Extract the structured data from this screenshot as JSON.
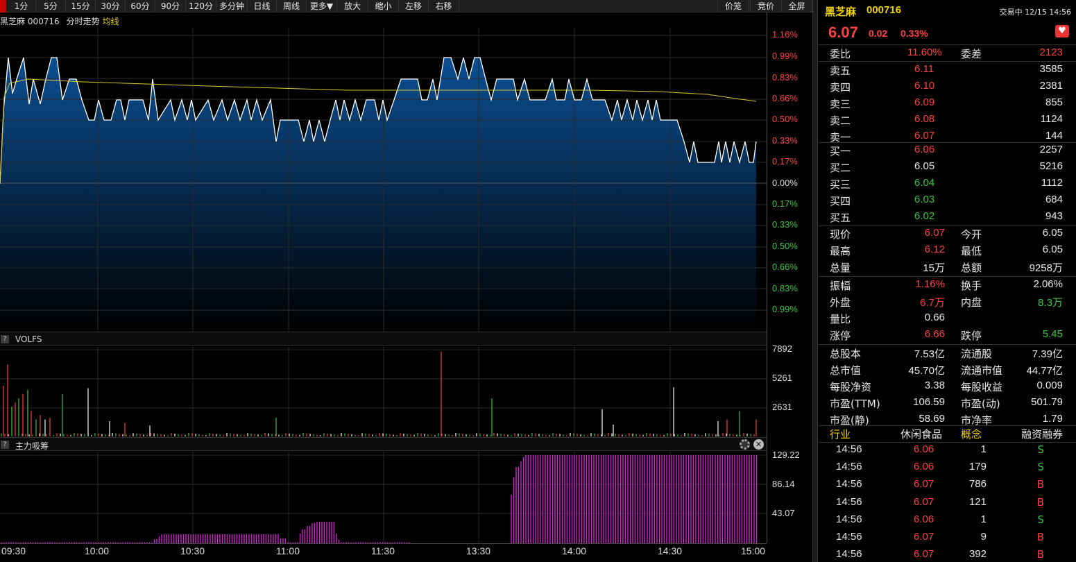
{
  "toolbar": {
    "items": [
      "1分",
      "5分",
      "15分",
      "30分",
      "60分",
      "90分",
      "120分",
      "多分钟",
      "日线",
      "周线",
      "更多▼",
      "放大",
      "缩小",
      "左移",
      "右移"
    ],
    "right_items": [
      "价笼",
      "竞价",
      "全屏"
    ]
  },
  "chart": {
    "stock_name": "黑芝麻",
    "stock_code": "000716",
    "subtitle": "分时走势",
    "avg_label": "均线",
    "pct_labels_up": [
      "1.16%",
      "0.99%",
      "0.83%",
      "0.66%",
      "0.50%",
      "0.33%",
      "0.17%"
    ],
    "zero_label": "0.00%",
    "pct_labels_down": [
      "0.17%",
      "0.33%",
      "0.50%",
      "0.66%",
      "0.83%",
      "0.99%"
    ],
    "colors": {
      "up": "#ff4040",
      "down": "#3cc43c",
      "fill_top": "#0b4f93",
      "avg": "#d8c830",
      "zl": "#e020e0"
    }
  },
  "chart_data": [
    {
      "type": "area",
      "title": "分时走势",
      "series": [
        {
          "name": "均线",
          "values": [
            6.05,
            6.1,
            6.1,
            6.098,
            6.096,
            6.094,
            6.093,
            6.092,
            6.091,
            6.09
          ]
        }
      ],
      "xlabel": "",
      "ylabel": "",
      "x": [
        "09:30",
        "10:00",
        "10:30",
        "11:00",
        "11:30",
        "13:30",
        "14:00",
        "14:30",
        "15:00"
      ],
      "ylim": [
        5.98,
        6.12
      ]
    },
    {
      "type": "bar",
      "title": "VOLFS",
      "ylim": [
        0,
        8000
      ],
      "tick_labels": [
        "7892",
        "5261",
        "2631"
      ],
      "peaks": [
        {
          "x": "11:45",
          "value": 7892
        },
        {
          "x": "09:31",
          "value": 6700
        }
      ]
    },
    {
      "type": "bar",
      "title": "主力吸筹",
      "ylim": [
        0,
        135
      ],
      "tick_labels": [
        "129.22",
        "86.14",
        "43.07"
      ],
      "segments": [
        {
          "from": "10:28",
          "to": "11:00",
          "value": 10
        },
        {
          "from": "11:03",
          "to": "11:17",
          "value": 30
        },
        {
          "from": "13:40",
          "to": "15:00",
          "value": 129.22
        }
      ]
    }
  ],
  "volume": {
    "title": "VOLFS",
    "labels": [
      "7892",
      "5261",
      "2631"
    ]
  },
  "zl": {
    "title": "主力吸筹",
    "labels": [
      "129.22",
      "86.14",
      "43.07"
    ]
  },
  "time_labels": [
    "09:30",
    "10:00",
    "10:30",
    "11:00",
    "11:30",
    "13:30",
    "14:00",
    "14:30",
    "15:00"
  ],
  "quote": {
    "name": "黑芝麻",
    "code": "000716",
    "status": "交易中 12/15 14:56",
    "price": "6.07",
    "change": "0.02",
    "change_pct": "0.33%",
    "weibi_label": "委比",
    "weibi": "11.60%",
    "weicha_label": "委差",
    "weicha": "2123",
    "asks": [
      {
        "label": "卖五",
        "price": "6.11",
        "vol": "3585"
      },
      {
        "label": "卖四",
        "price": "6.10",
        "vol": "2381"
      },
      {
        "label": "卖三",
        "price": "6.09",
        "vol": "855"
      },
      {
        "label": "卖二",
        "price": "6.08",
        "vol": "1124"
      },
      {
        "label": "卖一",
        "price": "6.07",
        "vol": "144"
      }
    ],
    "bids": [
      {
        "label": "买一",
        "price": "6.06",
        "vol": "2257",
        "c": "red"
      },
      {
        "label": "买二",
        "price": "6.05",
        "vol": "5216",
        "c": "white"
      },
      {
        "label": "买三",
        "price": "6.04",
        "vol": "1112",
        "c": "green"
      },
      {
        "label": "买四",
        "price": "6.03",
        "vol": "684",
        "c": "green"
      },
      {
        "label": "买五",
        "price": "6.02",
        "vol": "943",
        "c": "green"
      }
    ],
    "stats": [
      {
        "l1": "现价",
        "v1": "6.07",
        "c1": "red",
        "l2": "今开",
        "v2": "6.05",
        "c2": "white"
      },
      {
        "l1": "最高",
        "v1": "6.12",
        "c1": "red",
        "l2": "最低",
        "v2": "6.05",
        "c2": "white"
      },
      {
        "l1": "总量",
        "v1": "15万",
        "c1": "white",
        "l2": "总额",
        "v2": "9258万",
        "c2": "white"
      },
      {
        "l1": "振幅",
        "v1": "1.16%",
        "c1": "red",
        "l2": "换手",
        "v2": "2.06%",
        "c2": "white"
      },
      {
        "l1": "外盘",
        "v1": "6.7万",
        "c1": "red",
        "l2": "内盘",
        "v2": "8.3万",
        "c2": "green"
      },
      {
        "l1": "量比",
        "v1": "0.66",
        "c1": "white",
        "l2": "",
        "v2": "",
        "c2": "white"
      },
      {
        "l1": "涨停",
        "v1": "6.66",
        "c1": "red",
        "l2": "跌停",
        "v2": "5.45",
        "c2": "green"
      },
      {
        "l1": "总股本",
        "v1": "7.53亿",
        "c1": "white",
        "l2": "流通股",
        "v2": "7.39亿",
        "c2": "white"
      },
      {
        "l1": "总市值",
        "v1": "45.70亿",
        "c1": "white",
        "l2": "流通市值",
        "v2": "44.77亿",
        "c2": "white"
      },
      {
        "l1": "每股净资",
        "v1": "3.38",
        "c1": "white",
        "l2": "每股收益",
        "v2": "0.009",
        "c2": "white"
      },
      {
        "l1": "市盈(TTM)",
        "v1": "106.59",
        "c1": "white",
        "l2": "市盈(动)",
        "v2": "501.79",
        "c2": "white"
      },
      {
        "l1": "市盈(静)",
        "v1": "58.69",
        "c1": "white",
        "l2": "市净率",
        "v2": "1.79",
        "c2": "white"
      }
    ],
    "industry_label": "行业",
    "industry": "休闲食品",
    "concept_label": "概念",
    "margin": "融资融券",
    "trades": [
      {
        "t": "14:56",
        "p": "6.06",
        "pc": "red",
        "v": "1",
        "d": "S",
        "dc": "green"
      },
      {
        "t": "14:56",
        "p": "6.06",
        "pc": "red",
        "v": "179",
        "d": "S",
        "dc": "green"
      },
      {
        "t": "14:56",
        "p": "6.07",
        "pc": "red",
        "v": "786",
        "d": "B",
        "dc": "red"
      },
      {
        "t": "14:56",
        "p": "6.07",
        "pc": "red",
        "v": "121",
        "d": "B",
        "dc": "red"
      },
      {
        "t": "14:56",
        "p": "6.06",
        "pc": "red",
        "v": "1",
        "d": "S",
        "dc": "green"
      },
      {
        "t": "14:56",
        "p": "6.07",
        "pc": "red",
        "v": "9",
        "d": "B",
        "dc": "red"
      },
      {
        "t": "14:56",
        "p": "6.07",
        "pc": "red",
        "v": "392",
        "d": "B",
        "dc": "red"
      }
    ]
  }
}
